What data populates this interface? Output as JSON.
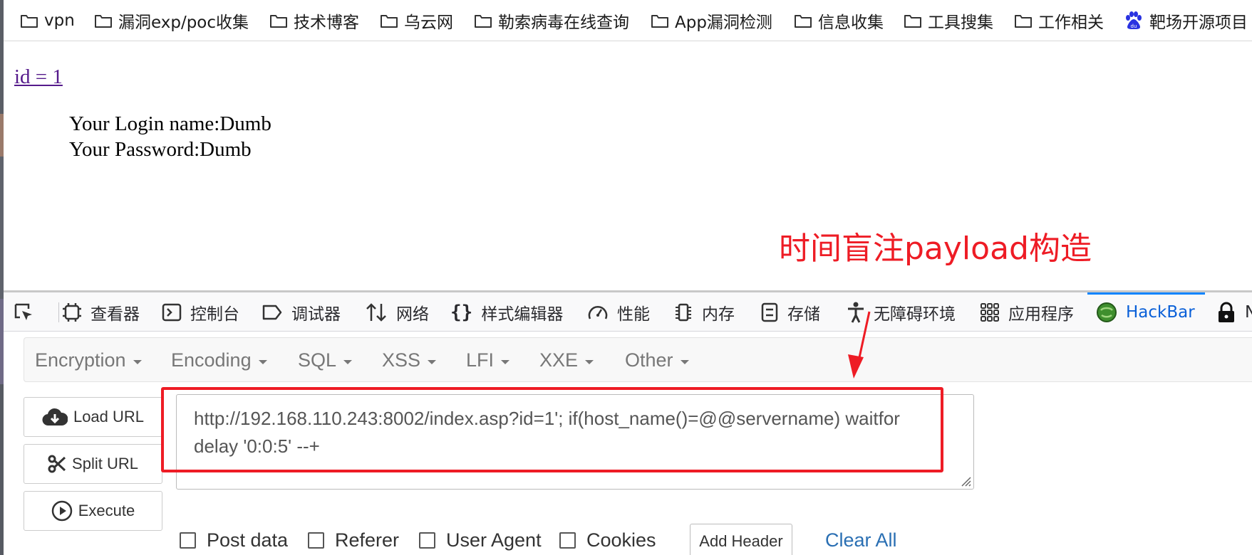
{
  "bookmarks": [
    {
      "label": "vpn",
      "icon": "folder-icon"
    },
    {
      "label": "漏洞exp/poc收集",
      "icon": "folder-icon"
    },
    {
      "label": "技术博客",
      "icon": "folder-icon"
    },
    {
      "label": "乌云网",
      "icon": "folder-icon"
    },
    {
      "label": "勒索病毒在线查询",
      "icon": "folder-icon"
    },
    {
      "label": "App漏洞检测",
      "icon": "folder-icon"
    },
    {
      "label": "信息收集",
      "icon": "folder-icon"
    },
    {
      "label": "工具搜集",
      "icon": "folder-icon"
    },
    {
      "label": "工作相关",
      "icon": "folder-icon"
    },
    {
      "label": "靶场开源项目",
      "icon": "baidu-paw-icon"
    }
  ],
  "page": {
    "id_link": "id = 1",
    "login_name": "Your Login name:Dumb",
    "password": "Your Password:Dumb",
    "annotation": "时间盲注payload构造"
  },
  "devtools": {
    "tabs": [
      {
        "label": "查看器",
        "icon": "inspector-icon"
      },
      {
        "label": "控制台",
        "icon": "console-icon"
      },
      {
        "label": "调试器",
        "icon": "debugger-icon"
      },
      {
        "label": "网络",
        "icon": "network-icon"
      },
      {
        "label": "样式编辑器",
        "icon": "style-editor-icon"
      },
      {
        "label": "性能",
        "icon": "performance-icon"
      },
      {
        "label": "内存",
        "icon": "memory-icon"
      },
      {
        "label": "存储",
        "icon": "storage-icon"
      },
      {
        "label": "无障碍环境",
        "icon": "accessibility-icon"
      },
      {
        "label": "应用程序",
        "icon": "application-icon"
      },
      {
        "label": "HackBar",
        "icon": "hackbar-icon",
        "active": true
      },
      {
        "label": "N",
        "icon": "lock-icon"
      }
    ]
  },
  "hackbar": {
    "menus": [
      "Encryption",
      "Encoding",
      "SQL",
      "XSS",
      "LFI",
      "XXE",
      "Other"
    ],
    "load_url": "Load URL",
    "split_url": "Split URL",
    "execute": "Execute",
    "url_value": "http://192.168.110.243:8002/index.asp?id=1'; if(host_name()=@@servername) waitfor delay '0:0:5' --+",
    "options": [
      "Post data",
      "Referer",
      "User Agent",
      "Cookies"
    ],
    "add_header": "Add Header",
    "clear_all": "Clear All"
  },
  "colors": {
    "annotation_red": "#ee1c25",
    "hackbar_active": "#0a60d8",
    "visited_link": "#551a8b",
    "clear_all_link": "#2a6fb3"
  }
}
